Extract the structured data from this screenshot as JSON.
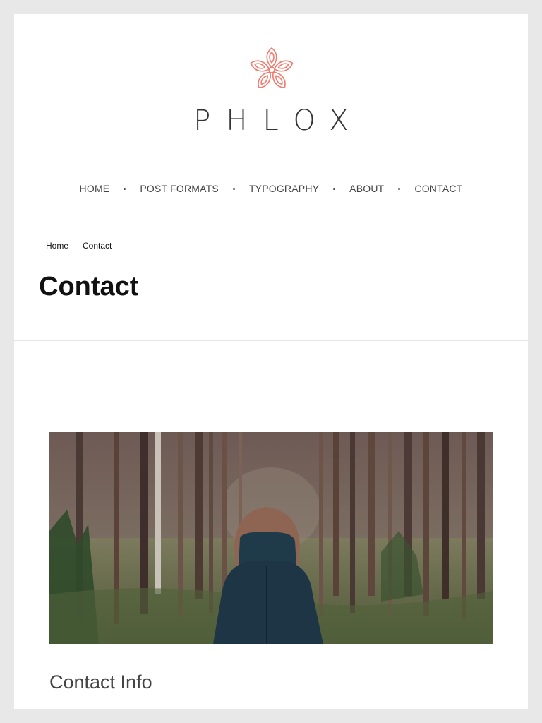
{
  "site": {
    "brand": "PHLOX",
    "accent_color": "#f07b6e",
    "logo_icon": "flower-logo-icon"
  },
  "nav": {
    "items": [
      {
        "label": "HOME"
      },
      {
        "label": "POST FORMATS"
      },
      {
        "label": "TYPOGRAPHY"
      },
      {
        "label": "ABOUT"
      },
      {
        "label": "CONTACT"
      }
    ]
  },
  "breadcrumb": {
    "home": "Home",
    "current": "Contact"
  },
  "page": {
    "title": "Contact"
  },
  "hero": {
    "image": "forest-woman-photo"
  },
  "section": {
    "title": "Contact Info"
  }
}
